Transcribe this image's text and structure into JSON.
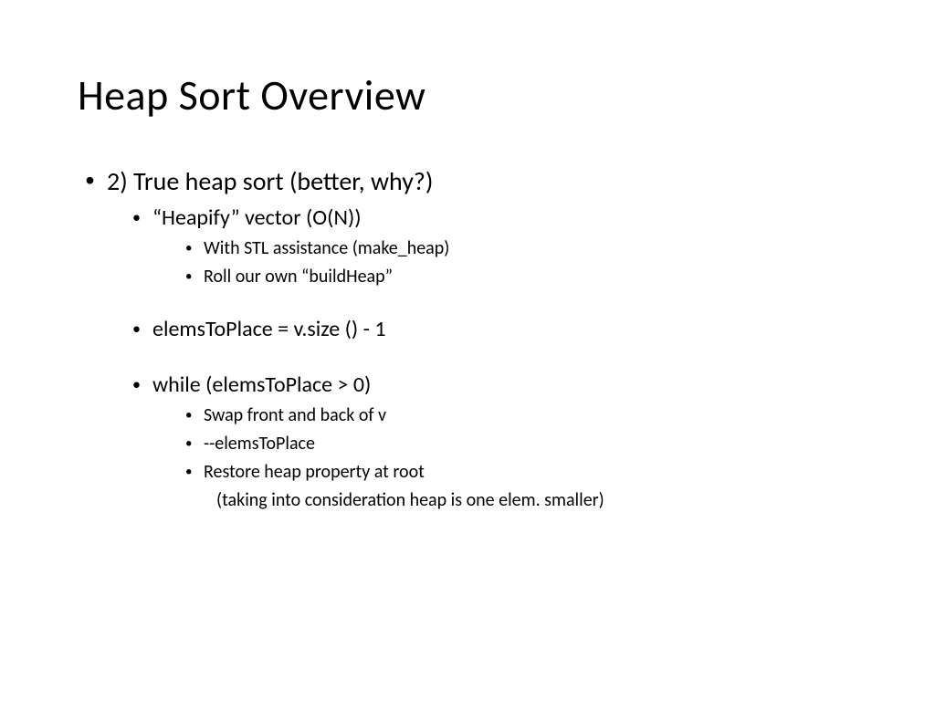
{
  "title": "Heap Sort Overview",
  "b1": "2) True heap sort (better, why?)",
  "b1_1": "“Heapify” vector (O(N))",
  "b1_1_1": "With STL assistance (make_heap)",
  "b1_1_2": "Roll our own “buildHeap”",
  "b1_2": "elemsToPlace = v.size () - 1",
  "b1_3": "while (elemsToPlace > 0)",
  "b1_3_1": "Swap front and back of v",
  "b1_3_2": "--elemsToPlace",
  "b1_3_3": "Restore heap property at root",
  "b1_3_3_cont": "(taking into consideration heap is one elem. smaller)"
}
